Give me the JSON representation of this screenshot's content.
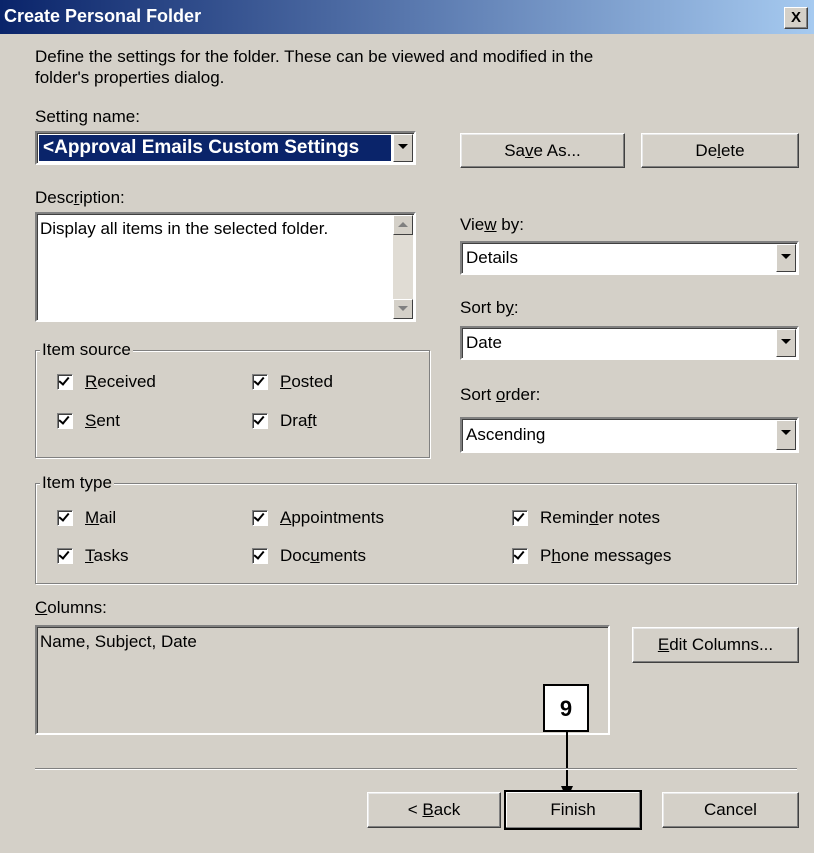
{
  "window": {
    "title": "Create Personal Folder",
    "close_glyph": "X"
  },
  "intro_text_line1": "Define the settings for the folder.  These can be viewed and modified in the",
  "intro_text_line2": "folder's properties dialog.",
  "setting_name": {
    "label_pre": "Settin",
    "label_key": "g",
    "label_post": " name:",
    "value": "<Approval Emails Custom Settings"
  },
  "buttons": {
    "save_as_pre": "Sa",
    "save_as_key": "v",
    "save_as_post": "e As...",
    "delete_pre": "De",
    "delete_key": "l",
    "delete_post": "ete",
    "edit_columns_key": "E",
    "edit_columns_post": "dit Columns...",
    "back_pre": "< ",
    "back_key": "B",
    "back_post": "ack",
    "finish": "Finish",
    "cancel": "Cancel"
  },
  "description": {
    "label_pre": "Desc",
    "label_key": "r",
    "label_post": "iption:",
    "value": "Display all items in the selected folder."
  },
  "view_by": {
    "label_pre": "Vie",
    "label_key": "w",
    "label_post": " by:",
    "value": "Details"
  },
  "sort_by": {
    "label_pre": "Sort b",
    "label_key": "y",
    "label_post": ":",
    "value": "Date"
  },
  "sort_order": {
    "label_pre": "Sort ",
    "label_key": "o",
    "label_post": "rder:",
    "value": "Ascending"
  },
  "item_source": {
    "title": "Item source",
    "received": {
      "key": "R",
      "post": "eceived",
      "checked": true
    },
    "posted": {
      "key": "P",
      "post": "osted",
      "checked": true
    },
    "sent": {
      "key": "S",
      "post": "ent",
      "checked": true
    },
    "draft": {
      "pre": "Dra",
      "key": "f",
      "post": "t",
      "checked": true
    }
  },
  "item_type": {
    "title": "Item type",
    "mail": {
      "key": "M",
      "post": "ail",
      "checked": true
    },
    "appointments": {
      "key": "A",
      "post": "ppointments",
      "checked": true
    },
    "reminder": {
      "pre": "Remin",
      "key": "d",
      "post": "er notes",
      "checked": true
    },
    "tasks": {
      "key": "T",
      "post": "asks",
      "checked": true
    },
    "documents": {
      "pre": "Doc",
      "key": "u",
      "post": "ments",
      "checked": true
    },
    "phone": {
      "pre": "P",
      "key": "h",
      "post": "one messages",
      "checked": true
    }
  },
  "columns": {
    "label_key": "C",
    "label_post": "olumns:",
    "value": "Name, Subject, Date"
  },
  "callout": "9",
  "colors": {
    "dialog_bg": "#d4d0c8",
    "title_start": "#0a246a",
    "title_end": "#a6caf0",
    "selection": "#0a246a"
  },
  "icons": [
    "close-icon",
    "dropdown-arrow-icon",
    "scroll-up-icon",
    "scroll-down-icon",
    "checkmark-icon",
    "arrow-icon"
  ]
}
